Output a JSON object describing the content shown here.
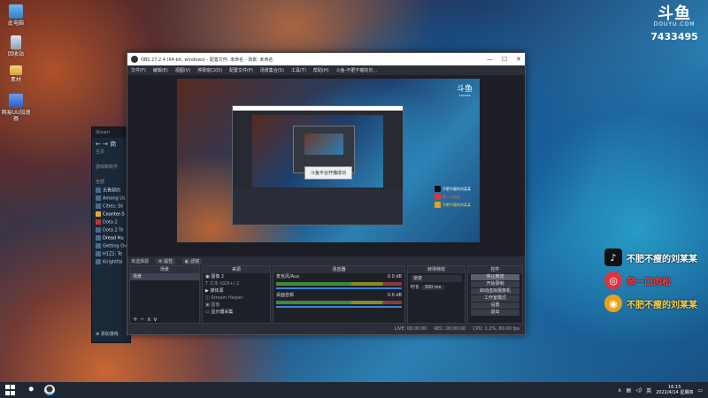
{
  "desktop": {
    "icons": [
      {
        "label": "此电脑",
        "color": "#4aa3e8"
      },
      {
        "label": "回收站",
        "color": "#9fb6c9"
      },
      {
        "label": "素材",
        "color": "#e8b84a"
      },
      {
        "label": "网易UU加速器",
        "color": "#3a7bd5"
      }
    ]
  },
  "douyu": {
    "logo_text": "斗鱼",
    "site": "DOUYU.COM",
    "room_number": "7433495"
  },
  "social": {
    "items": [
      {
        "icon": "tiktok-icon",
        "glyph": "♪",
        "bg": "#111111",
        "text": "不肥不瘦的刘某某",
        "color": "#ffffff"
      },
      {
        "icon": "fan-group-icon",
        "glyph": "◎",
        "bg": "#e0343c",
        "text": "亲一口肉松",
        "color": "#ff3b3b"
      },
      {
        "icon": "weibo-icon",
        "glyph": "◉",
        "bg": "#e6a21a",
        "text": "不肥不瘦的刘某某",
        "color": "#ffd34a"
      }
    ]
  },
  "steam": {
    "title": "Steam",
    "nav": "商",
    "sections": [
      "主页",
      "游戏和软件"
    ],
    "games_header": "全部",
    "games": [
      "无畏契约",
      "Among Us",
      "Cities: Sk",
      "Counter-S",
      "Dota 2",
      "Dota 2 Te",
      "Dread Hu",
      "Getting Ov",
      "H1Z1: Te",
      "Knightfal"
    ],
    "add_game": "添加游戏"
  },
  "obs": {
    "title": "OBS 27.2.4 (64-bit, windows) - 配置文件: 未命名 - 场景: 未命名",
    "menu": [
      "文件(F)",
      "编辑(E)",
      "视图(V)",
      "停靠窗口(D)",
      "配置文件(P)",
      "场景集合(S)",
      "工具(T)",
      "帮助(H)",
      "斗鱼-不肥不瘦的刘..."
    ],
    "preview": {
      "logo": "斗鱼",
      "logo_sub": "7433495",
      "status_popup": "斗鱼平台开播成功",
      "mini_social": [
        "不肥不瘦的刘某某",
        "亲一口肉松",
        "不肥不瘦的刘某某"
      ]
    },
    "dock_bar": {
      "no_source": "未选择源",
      "properties": "属性",
      "filters": "滤镜"
    },
    "scenes": {
      "header": "场景",
      "items": [
        "场景"
      ]
    },
    "sources": {
      "header": "来源",
      "items": [
        "图像 2",
        "文本 (GDI+) 2",
        "媒体源",
        "Stream Helper",
        "图像",
        "显示器采集"
      ]
    },
    "mixer": {
      "header": "混音器",
      "tracks": [
        {
          "name": "麦克风/Aux",
          "level": "0.0 dB"
        },
        {
          "name": "桌面音频",
          "level": "0.0 dB"
        }
      ]
    },
    "transitions": {
      "header": "转场特效",
      "type": "渐变",
      "duration_label": "时长",
      "duration": "300 ms"
    },
    "controls": {
      "header": "控件",
      "buttons": [
        "停止推流",
        "开始录制",
        "启动虚拟摄像机",
        "工作室模式",
        "设置",
        "退出"
      ]
    },
    "statusbar": {
      "live": "LIVE: 00:00:00",
      "rec": "REC: 00:00:00",
      "cpu": "CPU: 1.2%, 60.00 fps"
    }
  },
  "taskbar": {
    "time": "16:15",
    "date": "2022/4/14 星期四",
    "lang": "英"
  }
}
